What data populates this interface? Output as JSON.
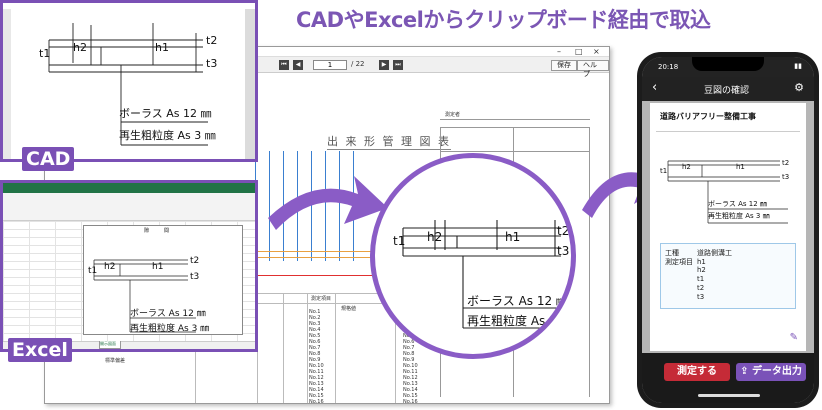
{
  "headline": "CADやExcelからクリップボード経由で取込",
  "labels": {
    "cad": "CAD",
    "excel": "Excel"
  },
  "drawing": {
    "t1": "t1",
    "t2": "t2",
    "t3": "t3",
    "h1": "h1",
    "h2": "h2",
    "line1": "ボーラス As 12 ㎜",
    "line2": "再生粗粒度 As 3 ㎜"
  },
  "doc_window": {
    "page_current": "1",
    "page_total": "/ 22",
    "save_label": "保存",
    "help_label": "ヘルプ",
    "doc_title": "出 来 形 管 理 図 表",
    "measure_item": "測定項目",
    "spec": "規格値",
    "work_type": "測定者",
    "row_labels": [
      "No.1",
      "No.2",
      "No.3",
      "No.4",
      "No.5",
      "No.6",
      "No.7",
      "No.8",
      "No.9",
      "No.10",
      "No.11",
      "No.12",
      "No.13",
      "No.14",
      "No.15",
      "No.16"
    ],
    "footer_label": "標準偏差"
  },
  "excel_window": {
    "sheet_tab": "開示図面",
    "col_header": "隙　　　間"
  },
  "phone": {
    "time": "20:18",
    "nav_title": "豆図の確認",
    "project_title": "道路バリアフリー整備工事",
    "info_rows": [
      {
        "key": "工種",
        "value": "道路側溝工"
      },
      {
        "key": "測定項目",
        "value": "h1"
      },
      {
        "key": "",
        "value": "h2"
      },
      {
        "key": "",
        "value": "t1"
      },
      {
        "key": "",
        "value": "t2"
      },
      {
        "key": "",
        "value": "t3"
      }
    ],
    "measure_button": "測定する",
    "export_button": "データ出力"
  },
  "colors": {
    "accent": "#7b56b4",
    "measure": "#c52b37",
    "export": "#7a52b8"
  }
}
